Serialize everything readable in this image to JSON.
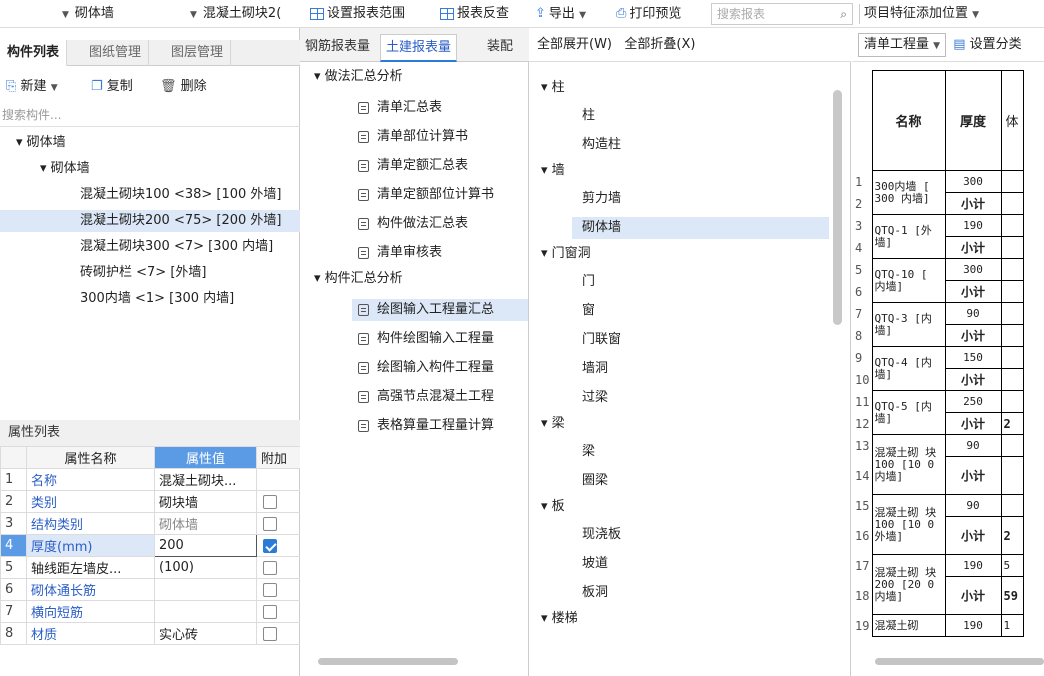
{
  "toolbar": {
    "filter1": "砌体墙",
    "filter2": "混凝土砌块2(",
    "set_range": "设置报表范围",
    "reverse_check": "报表反查",
    "export": "导出",
    "print_preview": "打印预览",
    "search_placeholder": "搜索报表",
    "add_position": "项目特征添加位置"
  },
  "left_panel": {
    "tabs": [
      "构件列表",
      "图纸管理",
      "图层管理"
    ],
    "actions": {
      "new": "新建",
      "copy": "复制",
      "delete": "删除"
    },
    "search_placeholder": "搜索构件...",
    "tree": [
      {
        "label": "砌体墙",
        "level": 0
      },
      {
        "label": "砌体墙",
        "level": 1
      },
      {
        "label": "混凝土砌块100 <38> [100 外墙]",
        "level": 2
      },
      {
        "label": "混凝土砌块200 <75> [200 外墙]",
        "level": 2,
        "selected": true
      },
      {
        "label": "混凝土砌块300 <7> [300 内墙]",
        "level": 2
      },
      {
        "label": "砖砌护栏 <7> [外墙]",
        "level": 2
      },
      {
        "label": "300内墙 <1> [300 内墙]",
        "level": 2
      }
    ]
  },
  "properties": {
    "title": "属性列表",
    "headers": [
      "属性名称",
      "属性值",
      "附加"
    ],
    "rows": [
      {
        "n": "1",
        "name": "名称",
        "value": "混凝土砌块...",
        "blue": true,
        "check": null
      },
      {
        "n": "2",
        "name": "类别",
        "value": "砌块墙",
        "blue": true,
        "check": false
      },
      {
        "n": "3",
        "name": "结构类别",
        "value": "砌体墙",
        "blue": true,
        "check": false
      },
      {
        "n": "4",
        "name": "厚度(mm)",
        "value": "200",
        "blue": true,
        "check": true,
        "selected": true
      },
      {
        "n": "5",
        "name": "轴线距左墙皮...",
        "value": "(100)",
        "blue": false,
        "check": false
      },
      {
        "n": "6",
        "name": "砌体通长筋",
        "value": "",
        "blue": true,
        "check": false
      },
      {
        "n": "7",
        "name": "横向短筋",
        "value": "",
        "blue": true,
        "check": false
      },
      {
        "n": "8",
        "name": "材质",
        "value": "实心砖",
        "blue": true,
        "check": false
      }
    ]
  },
  "reports": {
    "tabs": [
      "钢筋报表量",
      "土建报表量",
      "装配"
    ],
    "groups": [
      {
        "label": "做法汇总分析",
        "items": [
          "清单汇总表",
          "清单部位计算书",
          "清单定额汇总表",
          "清单定额部位计算书",
          "构件做法汇总表",
          "清单审核表"
        ]
      },
      {
        "label": "构件汇总分析",
        "items": [
          "绘图输入工程量汇总",
          "构件绘图输入工程量",
          "绘图输入构件工程量",
          "高强节点混凝土工程",
          "表格算量工程量计算"
        ]
      }
    ],
    "selected": "绘图输入工程量汇总"
  },
  "categories": {
    "expand_all": "全部展开(W)",
    "collapse_all": "全部折叠(X)",
    "groups": [
      {
        "label": "柱",
        "items": [
          "柱",
          "构造柱"
        ]
      },
      {
        "label": "墙",
        "items": [
          "剪力墙",
          "砌体墙"
        ]
      },
      {
        "label": "门窗洞",
        "items": [
          "门",
          "窗",
          "门联窗",
          "墙洞",
          "过梁"
        ]
      },
      {
        "label": "梁",
        "items": [
          "梁",
          "圈梁"
        ]
      },
      {
        "label": "板",
        "items": [
          "现浇板",
          "坡道",
          "板洞"
        ]
      },
      {
        "label": "楼梯",
        "items": []
      }
    ],
    "selected": "砌体墙"
  },
  "table_panel": {
    "mode": "清单工程量",
    "settings": "设置分类",
    "headers": [
      "名称",
      "厚度",
      "体"
    ],
    "rows": [
      {
        "rn": [
          "1",
          "2"
        ],
        "name": "300内墙 [ 300 内墙]",
        "cells": [
          [
            "300",
            ""
          ],
          [
            "小计",
            ""
          ]
        ]
      },
      {
        "rn": [
          "3",
          "4"
        ],
        "name": "QTQ-1 [外 墙]",
        "cells": [
          [
            "190",
            ""
          ],
          [
            "小计",
            ""
          ]
        ]
      },
      {
        "rn": [
          "5",
          "6"
        ],
        "name": "QTQ-10 [ 内墙]",
        "cells": [
          [
            "300",
            ""
          ],
          [
            "小计",
            ""
          ]
        ]
      },
      {
        "rn": [
          "7",
          "8"
        ],
        "name": "QTQ-3 [内 墙]",
        "cells": [
          [
            "90",
            ""
          ],
          [
            "小计",
            ""
          ]
        ]
      },
      {
        "rn": [
          "9",
          "10"
        ],
        "name": "QTQ-4 [内 墙]",
        "cells": [
          [
            "150",
            ""
          ],
          [
            "小计",
            ""
          ]
        ]
      },
      {
        "rn": [
          "11",
          "12"
        ],
        "name": "QTQ-5 [内 墙]",
        "cells": [
          [
            "250",
            ""
          ],
          [
            "小计",
            "2"
          ]
        ]
      },
      {
        "rn": [
          "13",
          "14"
        ],
        "name": "混凝土砌 块100 [10 0 内墙]",
        "cells": [
          [
            "90",
            ""
          ],
          [
            "小计",
            ""
          ]
        ]
      },
      {
        "rn": [
          "15",
          "16"
        ],
        "name": "混凝土砌 块100 [10 0 外墙]",
        "cells": [
          [
            "90",
            ""
          ],
          [
            "小计",
            "2"
          ]
        ]
      },
      {
        "rn": [
          "17",
          "18"
        ],
        "name": "混凝土砌 块200 [20 0 内墙]",
        "cells": [
          [
            "190",
            "5"
          ],
          [
            "小计",
            "59"
          ]
        ]
      },
      {
        "rn": [
          "19"
        ],
        "name": "混凝土砌",
        "cells": [
          [
            "190",
            "1"
          ]
        ]
      }
    ]
  }
}
